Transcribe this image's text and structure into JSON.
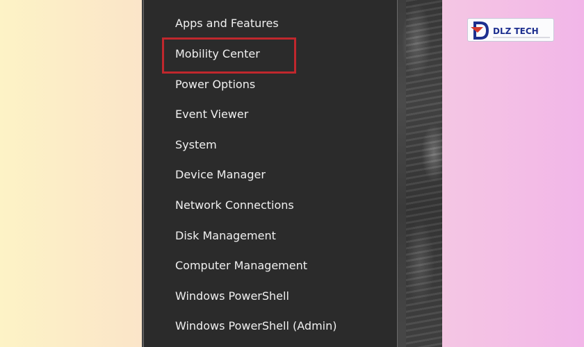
{
  "menu": {
    "items": [
      "Apps and Features",
      "Mobility Center",
      "Power Options",
      "Event Viewer",
      "System",
      "Device Manager",
      "Network Connections",
      "Disk Management",
      "Computer Management",
      "Windows PowerShell",
      "Windows PowerShell (Admin)"
    ],
    "highlighted_item": "Mobility Center",
    "highlight_color": "#c0272d"
  },
  "logo": {
    "text": "DLZ TECH",
    "primary_color": "#1d2f8f",
    "accent_color": "#d43a2f"
  }
}
